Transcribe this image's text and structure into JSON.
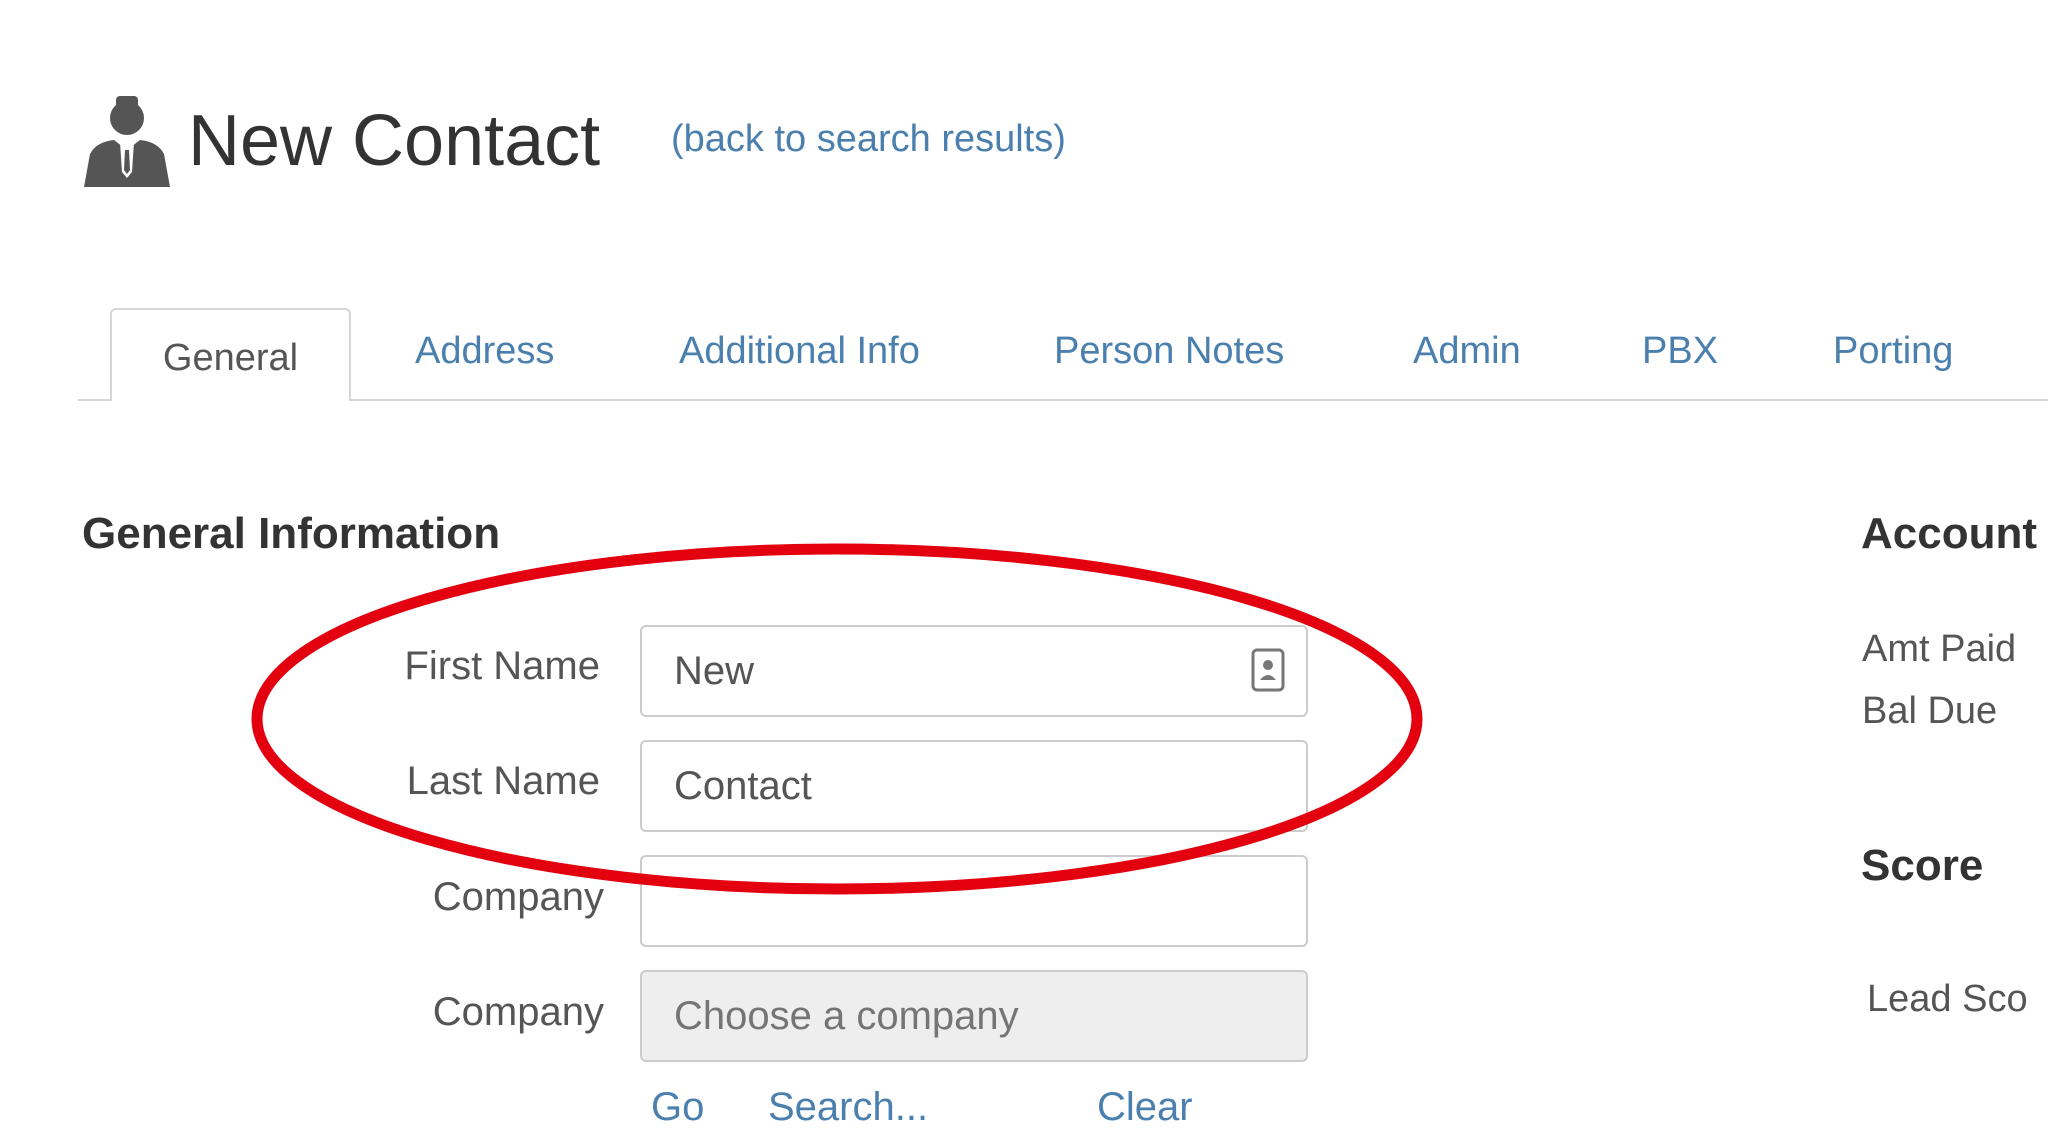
{
  "header": {
    "icon": "contact-person-icon",
    "title": "New Contact",
    "back_link": "(back to search results)"
  },
  "tabs": [
    {
      "label": "General",
      "active": true
    },
    {
      "label": "Address"
    },
    {
      "label": "Additional Info"
    },
    {
      "label": "Person Notes"
    },
    {
      "label": "Admin"
    },
    {
      "label": "PBX"
    },
    {
      "label": "Porting"
    }
  ],
  "general_info": {
    "heading": "General Information",
    "first_name": {
      "label": "First Name",
      "value": "New",
      "icon": "contact-card-icon"
    },
    "last_name": {
      "label": "Last Name",
      "value": "Contact"
    },
    "company_text": {
      "label": "Company",
      "value": ""
    },
    "company_select": {
      "label": "Company",
      "placeholder": "Choose a company"
    },
    "actions": {
      "go": "Go",
      "search": "Search...",
      "clear": "Clear"
    }
  },
  "account": {
    "heading": "Account",
    "amt_paid": "Amt Paid",
    "bal_due": "Bal Due"
  },
  "score": {
    "heading": "Score",
    "lead_score": "Lead Sco"
  },
  "colors": {
    "link": "#4a7fae",
    "annotation": "#e3000f",
    "text": "#333333"
  }
}
